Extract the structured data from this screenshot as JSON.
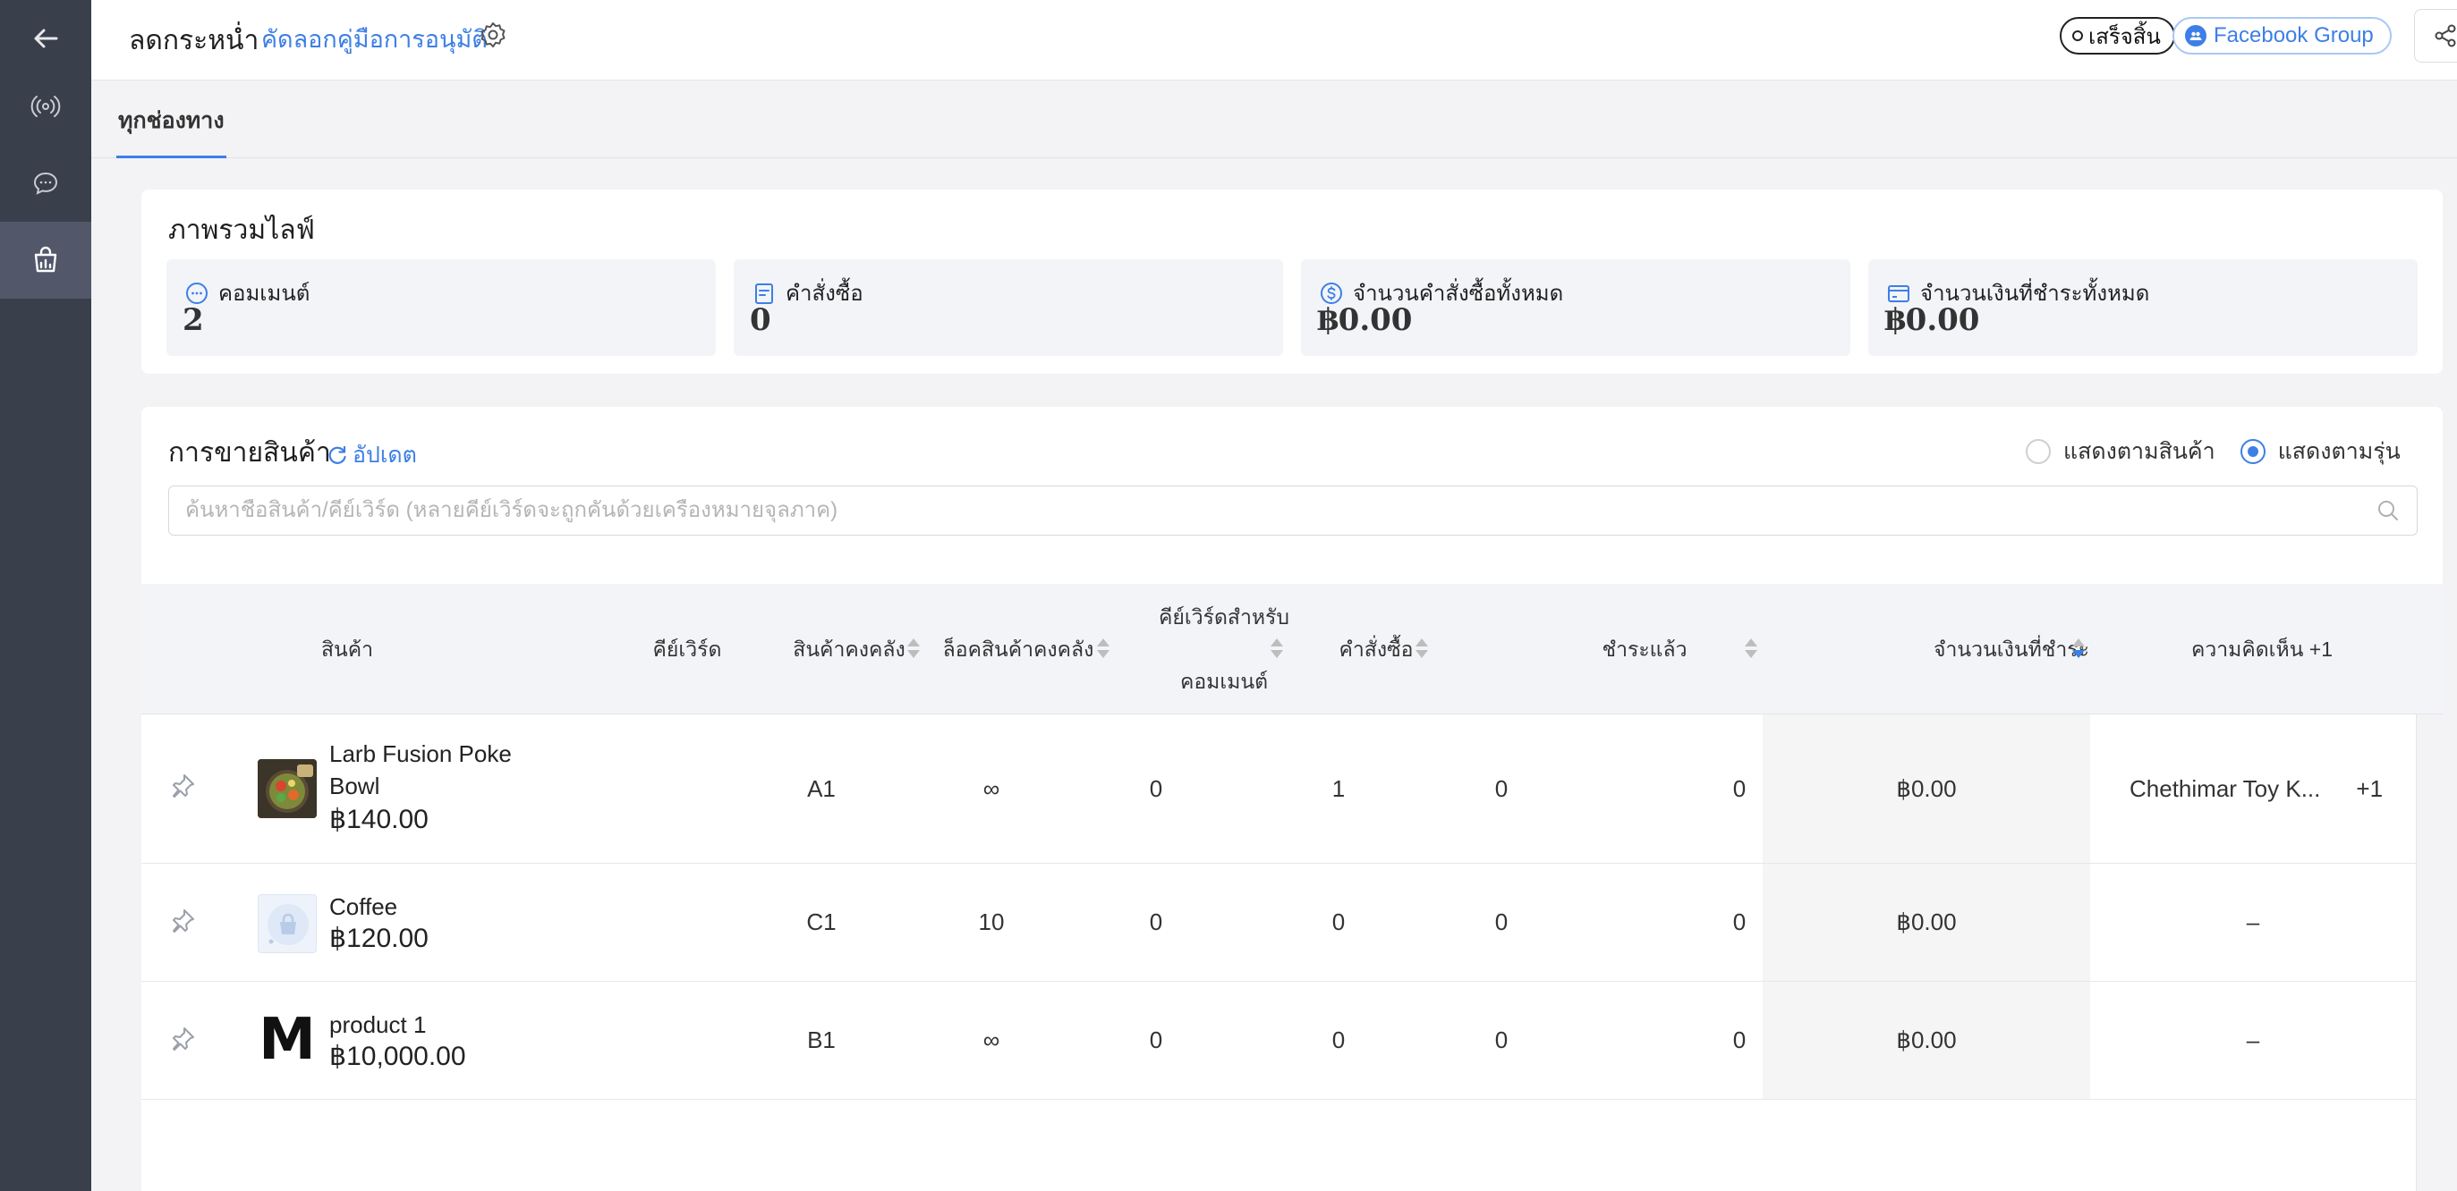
{
  "header": {
    "title": "ลดกระหน่ำ",
    "copy_link": "คัดลอกคู่มือการอนุมัติ",
    "done_label": "เสร็จสิ้น",
    "fb_group_label": "Facebook Group"
  },
  "channel_tab": "ทุกช่องทาง",
  "overview": {
    "title": "ภาพรวมไลฟ์",
    "stats": [
      {
        "label": "คอมเมนต์",
        "value": "2",
        "icon": "comment-icon"
      },
      {
        "label": "คำสั่งซื้อ",
        "value": "0",
        "icon": "order-icon"
      },
      {
        "label": "จำนวนคำสั่งซื้อทั้งหมด",
        "value": "฿0.00",
        "icon": "dollar-icon"
      },
      {
        "label": "จำนวนเงินที่ชำระทั้งหมด",
        "value": "฿0.00",
        "icon": "card-icon"
      }
    ]
  },
  "sales": {
    "title": "การขายสินค้า",
    "refresh_label": "อัปเดต",
    "view_by_product": "แสดงตามสินค้า",
    "view_by_variant": "แสดงตามรุ่น",
    "selected_view": "variant",
    "search_placeholder": "ค้นหาชื่อสินค้า/คีย์เวิร์ด (หลายคีย์เวิร์ดจะถูกคั่นด้วยเครื่องหมายจุลภาค)",
    "columns": {
      "product": "สินค้า",
      "keyword": "คีย์เวิร์ด",
      "stock": "สินค้าคงคลัง",
      "locked_stock": "ล็อคสินค้าคงคลัง",
      "comment_kw_1": "คีย์เวิร์ดสำหรับ",
      "comment_kw_2": "คอมเมนต์",
      "orders": "คำสั่งซื้อ",
      "paid": "ชำระแล้ว",
      "paid_amount": "จำนวนเงินที่ชำระ",
      "comments": "ความคิดเห็น +1"
    },
    "rows": [
      {
        "name_1": "Larb Fusion Poke",
        "name_2": "Bowl",
        "price": "฿140.00",
        "keyword": "A1",
        "stock": "∞",
        "locked": "0",
        "comment_kw": "1",
        "orders": "0",
        "paid": "0",
        "amount": "฿0.00",
        "comments": "Chethimar Toy K...",
        "comments_extra": "+1"
      },
      {
        "name_1": "Coffee",
        "name_2": "",
        "price": "฿120.00",
        "keyword": "C1",
        "stock": "10",
        "locked": "0",
        "comment_kw": "0",
        "orders": "0",
        "paid": "0",
        "amount": "฿0.00",
        "comments": "–",
        "comments_extra": ""
      },
      {
        "name_1": "product 1",
        "name_2": "",
        "price": "฿10,000.00",
        "keyword": "B1",
        "stock": "∞",
        "locked": "0",
        "comment_kw": "0",
        "orders": "0",
        "paid": "0",
        "amount": "฿0.00",
        "comments": "–",
        "comments_extra": ""
      }
    ],
    "thumb_letter": "M"
  },
  "colors": {
    "accent": "#3d7fe6",
    "sidebar": "#3a3f4c"
  }
}
